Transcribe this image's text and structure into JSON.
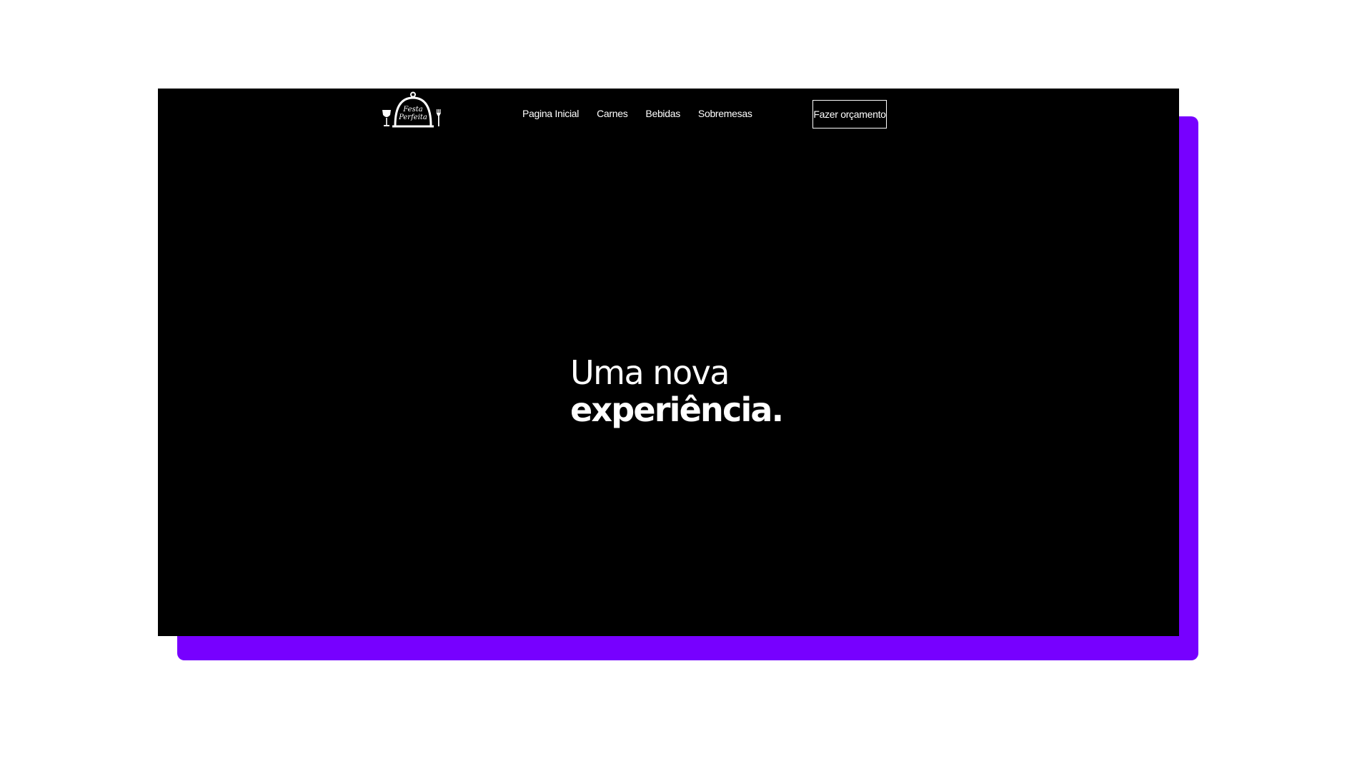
{
  "colors": {
    "page_background": "#ffffff",
    "screen_background": "#000000",
    "accent_shadow": "#7700ff",
    "text": "#ffffff"
  },
  "header": {
    "logo": {
      "icon_names": [
        "wine-glass-icon",
        "cloche-icon",
        "fork-icon"
      ],
      "text_line1": "Festa",
      "text_line2": "Perfeita"
    },
    "nav": [
      {
        "label": "Pagina Inicial"
      },
      {
        "label": "Carnes"
      },
      {
        "label": "Bebidas"
      },
      {
        "label": "Sobremesas"
      }
    ],
    "cta_label": "Fazer orçamento"
  },
  "hero": {
    "line1": "Uma nova",
    "line2": "experiência."
  }
}
